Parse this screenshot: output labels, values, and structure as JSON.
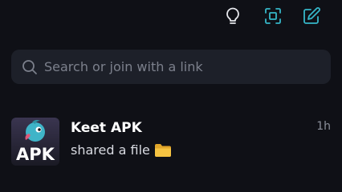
{
  "toolbar": {
    "icons": [
      "lightbulb-icon",
      "scan-qr-icon",
      "compose-icon"
    ],
    "accent_color": "#36b7c9"
  },
  "search": {
    "placeholder": "Search or join with a link",
    "value": ""
  },
  "chats": [
    {
      "name": "Keet APK",
      "preview": "shared a file",
      "preview_icon": "folder-icon",
      "time": "1h",
      "avatar_text": "APK"
    }
  ]
}
